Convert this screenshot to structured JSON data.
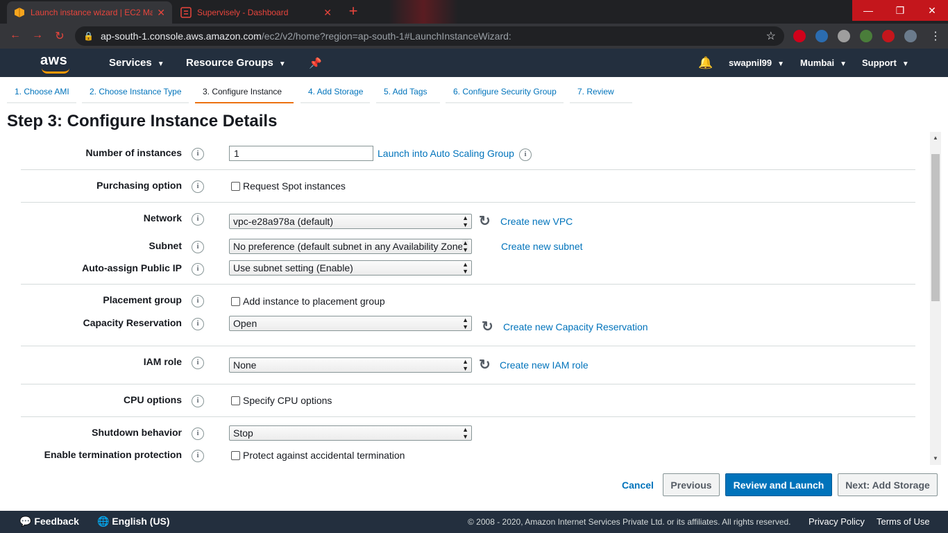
{
  "browser": {
    "tabs": [
      {
        "title": "Launch instance wizard | EC2 Ma",
        "icon": "aws-box-icon"
      },
      {
        "title": "Supervisely - Dashboard",
        "icon": "supervisely-icon"
      }
    ],
    "url_host": "ap-south-1.console.aws.amazon.com",
    "url_path": "/ec2/v2/home?region=ap-south-1#LaunchInstanceWizard:"
  },
  "header": {
    "logo": "aws",
    "services": "Services",
    "resource_groups": "Resource Groups",
    "user": "swapnil99",
    "region": "Mumbai",
    "support": "Support"
  },
  "steps": [
    {
      "label": "1. Choose AMI"
    },
    {
      "label": "2. Choose Instance Type"
    },
    {
      "label": "3. Configure Instance"
    },
    {
      "label": "4. Add Storage"
    },
    {
      "label": "5. Add Tags"
    },
    {
      "label": "6. Configure Security Group"
    },
    {
      "label": "7. Review"
    }
  ],
  "page_title": "Step 3: Configure Instance Details",
  "form": {
    "num_instances_label": "Number of instances",
    "num_instances_value": "1",
    "auto_scaling_link": "Launch into Auto Scaling Group",
    "purchasing_label": "Purchasing option",
    "spot_checkbox": "Request Spot instances",
    "network_label": "Network",
    "network_value": "vpc-e28a978a (default)",
    "create_vpc_link": "Create new VPC",
    "subnet_label": "Subnet",
    "subnet_value": "No preference (default subnet in any Availability Zone)",
    "create_subnet_link": "Create new subnet",
    "public_ip_label": "Auto-assign Public IP",
    "public_ip_value": "Use subnet setting (Enable)",
    "placement_label": "Placement group",
    "placement_checkbox": "Add instance to placement group",
    "capacity_label": "Capacity Reservation",
    "capacity_value": "Open",
    "create_capacity_link": "Create new Capacity Reservation",
    "iam_label": "IAM role",
    "iam_value": "None",
    "create_iam_link": "Create new IAM role",
    "cpu_label": "CPU options",
    "cpu_checkbox": "Specify CPU options",
    "shutdown_label": "Shutdown behavior",
    "shutdown_value": "Stop",
    "termination_label": "Enable termination protection",
    "termination_checkbox": "Protect against accidental termination"
  },
  "actions": {
    "cancel": "Cancel",
    "previous": "Previous",
    "review_launch": "Review and Launch",
    "next": "Next: Add Storage"
  },
  "footer": {
    "feedback": "Feedback",
    "language": "English (US)",
    "copyright": "© 2008 - 2020, Amazon Internet Services Private Ltd. or its affiliates. All rights reserved.",
    "privacy": "Privacy Policy",
    "terms": "Terms of Use"
  },
  "colors": {
    "aws_header": "#232f3e",
    "aws_orange": "#ff9900",
    "link_blue": "#0073bb",
    "active_step": "#ec7211"
  }
}
